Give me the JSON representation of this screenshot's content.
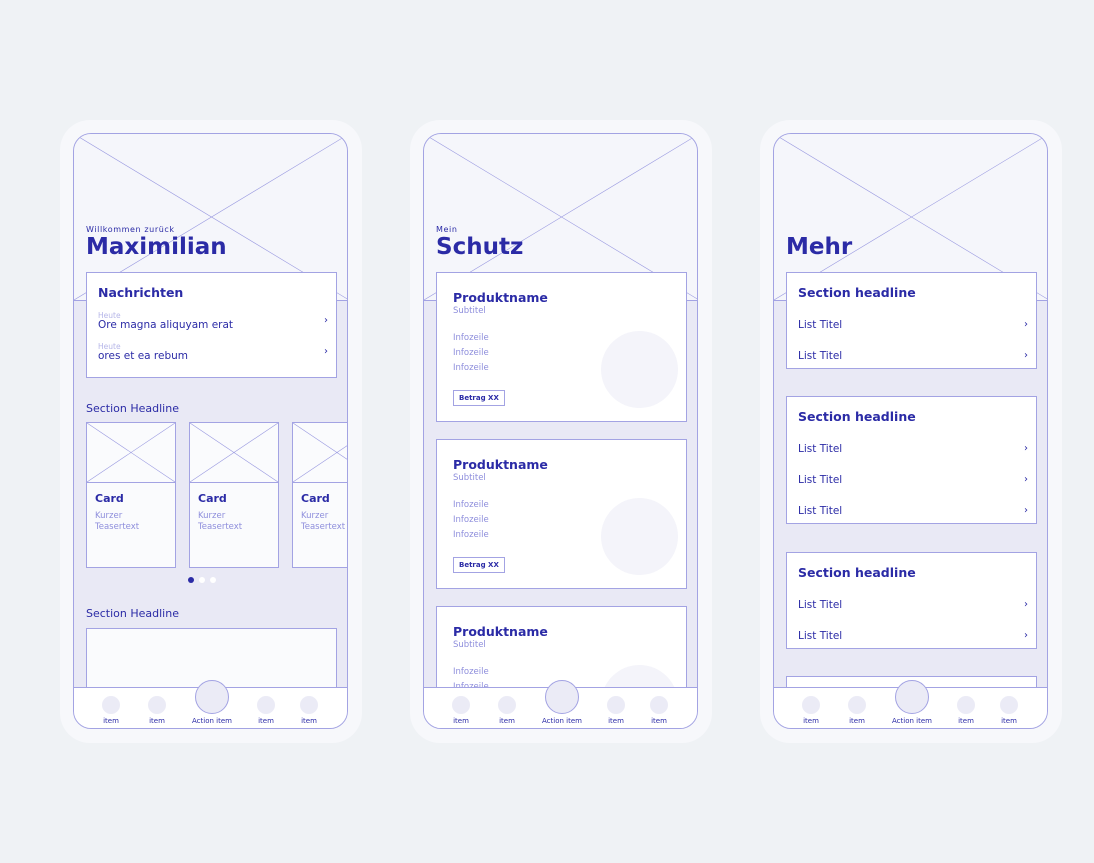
{
  "colors": {
    "primary": "#2b2ba6",
    "light": "#8e8edc",
    "border": "#a3a3e3",
    "background": "#eff2f5"
  },
  "tabbar": {
    "items": [
      "item",
      "item",
      "Action item",
      "item",
      "item"
    ]
  },
  "screens": [
    {
      "greeting": "Willkommen zurück",
      "title": "Maximilian",
      "messages": {
        "title": "Nachrichten",
        "items": [
          {
            "date": "Heute",
            "text": "Ore magna aliquyam erat"
          },
          {
            "date": "Heute",
            "text": "ores et ea rebum"
          }
        ]
      },
      "section1": "Section Headline",
      "cards": [
        {
          "title": "Card",
          "text": "Kurzer Teasertext"
        },
        {
          "title": "Card",
          "text": "Kurzer Teasertext"
        },
        {
          "title": "Card",
          "text": "Kurzer Teasertext"
        }
      ],
      "carousel_active": 1,
      "carousel_count": 3,
      "section2": "Section Headline"
    },
    {
      "greeting": "Mein",
      "title": "Schutz",
      "products": [
        {
          "name": "Produktname",
          "subtitle": "Subtitel",
          "info": [
            "Infozeile",
            "Infozeile",
            "Infozeile"
          ],
          "badge": "Betrag XX"
        },
        {
          "name": "Produktname",
          "subtitle": "Subtitel",
          "info": [
            "Infozeile",
            "Infozeile",
            "Infozeile"
          ],
          "badge": "Betrag XX"
        },
        {
          "name": "Produktname",
          "subtitle": "Subtitel",
          "info": [
            "Infozeile",
            "Infozeile"
          ]
        }
      ]
    },
    {
      "title": "Mehr",
      "sections": [
        {
          "headline": "Section headline",
          "items": [
            "List Titel",
            "List Titel"
          ]
        },
        {
          "headline": "Section headline",
          "items": [
            "List Titel",
            "List Titel",
            "List Titel"
          ]
        },
        {
          "headline": "Section headline",
          "items": [
            "List Titel",
            "List Titel"
          ]
        }
      ]
    }
  ]
}
